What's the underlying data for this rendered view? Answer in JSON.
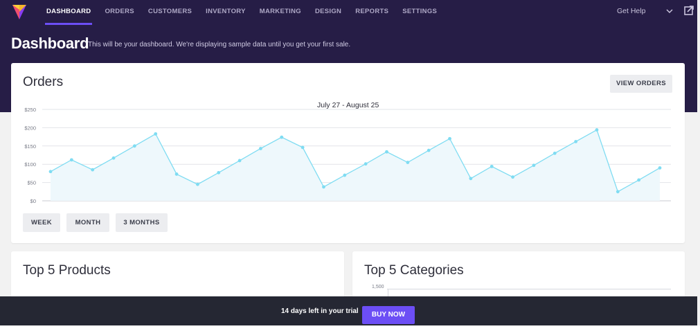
{
  "nav": {
    "tabs": [
      "DASHBOARD",
      "ORDERS",
      "CUSTOMERS",
      "INVENTORY",
      "MARKETING",
      "DESIGN",
      "REPORTS",
      "SETTINGS"
    ],
    "active_tab": "DASHBOARD",
    "get_help": "Get Help",
    "icons": [
      "logo",
      "chevron-down-icon",
      "external-link-icon"
    ]
  },
  "header": {
    "title": "Dashboard",
    "subtitle": "This will be your dashboard. We're displaying sample data until you get your first sale."
  },
  "orders": {
    "title": "Orders",
    "view_button": "VIEW ORDERS",
    "date_range": "July 27 - August 25",
    "period_buttons": [
      "WEEK",
      "MONTH",
      "3 MONTHS"
    ]
  },
  "chart_data": {
    "type": "area",
    "title": "July 27 - August 25",
    "xlabel": "",
    "ylabel": "",
    "ylim": [
      0,
      250
    ],
    "y_ticks": [
      "$250",
      "$200",
      "$150",
      "$100",
      "$50",
      "$0"
    ],
    "grid": true,
    "legend": "none",
    "line_color": "#7fdcf2",
    "fill_color": "#eef8fc",
    "series": [
      {
        "values": [
          80,
          112,
          85,
          117,
          150,
          183,
          73,
          45,
          77,
          110,
          143,
          174,
          146,
          38,
          70,
          101,
          134,
          105,
          138,
          170,
          61,
          94,
          65,
          97,
          130,
          162,
          194,
          25,
          57,
          90
        ]
      }
    ]
  },
  "products": {
    "title": "Top 5 Products"
  },
  "categories": {
    "title": "Top 5 Categories",
    "tick": "1,500"
  },
  "trial": {
    "text": "14 days left in your trial",
    "buy_button": "BUY NOW"
  },
  "colors": {
    "header_bg": "#261d46",
    "accent": "#6c4ef5",
    "trial_bg": "#252733"
  }
}
